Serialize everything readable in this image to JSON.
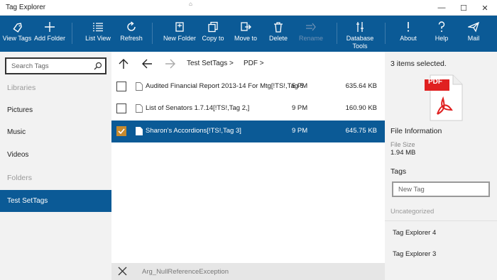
{
  "window": {
    "title": "Tag Explorer",
    "buttons": {
      "minimize": "—",
      "maximize": "☐",
      "close": "✕"
    }
  },
  "toolbar": {
    "view_tags": "View Tags",
    "add_folder": "Add Folder",
    "list_view": "List View",
    "refresh": "Refresh",
    "new_folder": "New Folder",
    "copy_to": "Copy to",
    "move_to": "Move to",
    "delete": "Delete",
    "rename": "Rename",
    "database_tools": "Database Tools",
    "about": "About",
    "help": "Help",
    "mail": "Mail"
  },
  "sidebar": {
    "search_placeholder": "Search Tags",
    "libraries_header": "Libraries",
    "items": [
      {
        "label": "Pictures"
      },
      {
        "label": "Music"
      },
      {
        "label": "Videos"
      }
    ],
    "folders_header": "Folders",
    "folders": [
      {
        "label": "Test SetTags",
        "selected": true
      }
    ]
  },
  "breadcrumb": {
    "items": [
      {
        "label": "Test SetTags",
        "sep": ">"
      },
      {
        "label": "PDF",
        "sep": ">"
      }
    ]
  },
  "files": [
    {
      "name": "Audited Financial Report 2013-14 For Mtg[!TS!,Tag 5",
      "time": "5 PM",
      "size": "635.64 KB",
      "checked": false,
      "selected": false
    },
    {
      "name": "List of Senators 1.7.14[!TS!,Tag 2,]",
      "time": "9 PM",
      "size": "160.90 KB",
      "checked": false,
      "selected": false
    },
    {
      "name": "Sharon's Accordions[!TS!,Tag 3]",
      "time": "9 PM",
      "size": "645.75 KB",
      "checked": true,
      "selected": true
    }
  ],
  "error": {
    "message": "Arg_NullReferenceException"
  },
  "details": {
    "selection_summary": "3 items selected.",
    "file_info_header": "File Information",
    "file_size_label": "File Size",
    "file_size_value": "1.94 MB",
    "tags_header": "Tags",
    "new_tag_placeholder": "New Tag",
    "uncategorized_header": "Uncategorized",
    "tags": [
      {
        "label": "Tag Explorer  4"
      },
      {
        "label": "Tag Explorer 3"
      }
    ],
    "pdf_badge": "PDF"
  },
  "colors": {
    "accent": "#0b5a96",
    "checkbox_checked": "#c68a2e",
    "pdf_red": "#e02020"
  }
}
